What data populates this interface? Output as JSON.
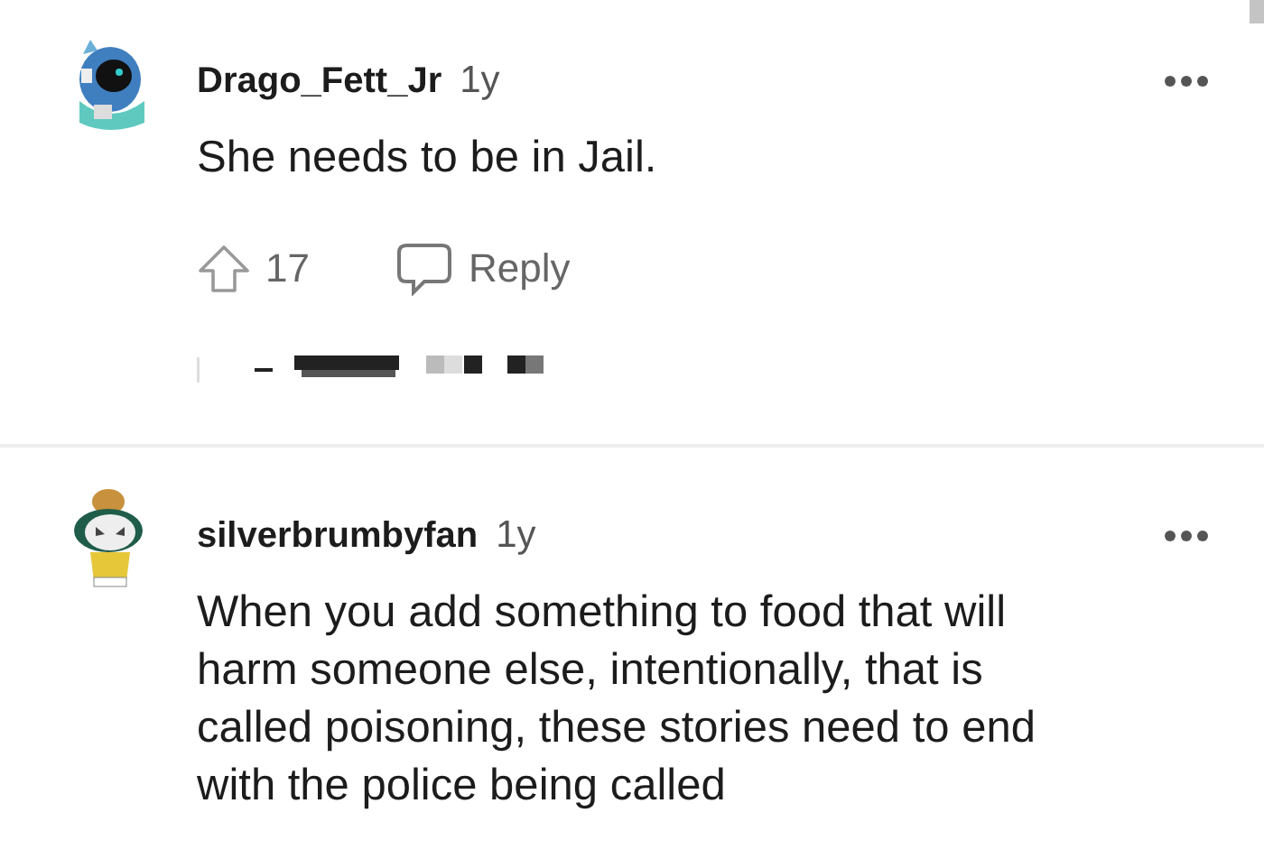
{
  "comments": [
    {
      "kind": "robot",
      "username": "Drago_Fett_Jr",
      "age": "1y",
      "text": "She needs to be in Jail.",
      "upvotes": "17",
      "reply_label": "Reply",
      "more_replies_obscured": true
    },
    {
      "kind": "bird",
      "username": "silverbrumbyfan",
      "age": "1y",
      "text": "When you add something to food that will harm someone else, intentionally, that is called poisoning, these stories need to end with the police being called"
    }
  ]
}
